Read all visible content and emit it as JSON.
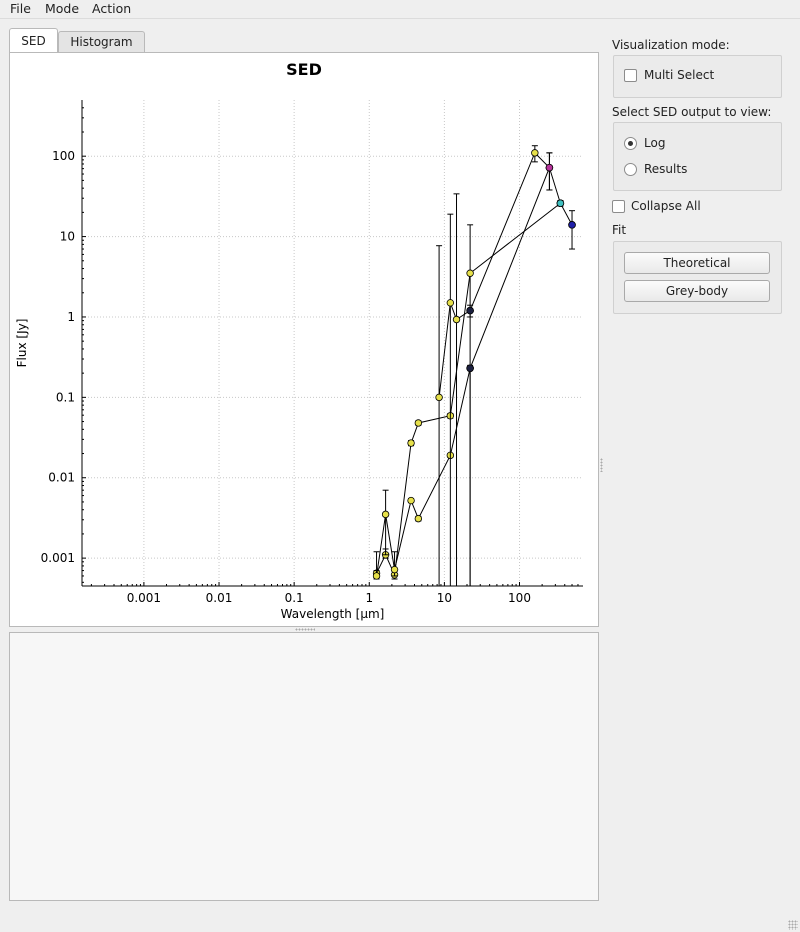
{
  "menubar": {
    "items": [
      "File",
      "Mode",
      "Action"
    ]
  },
  "tabs": [
    "SED",
    "Histogram"
  ],
  "chart_data": {
    "type": "scatter",
    "title": "SED",
    "xlabel": "Wavelength [µm]",
    "ylabel": "Flux [Jy]",
    "xscale": "log",
    "yscale": "log",
    "xlim": [
      0.00015,
      700
    ],
    "ylim": [
      0.00045,
      500
    ],
    "xticks": [
      0.001,
      0.01,
      0.1,
      1,
      10,
      100
    ],
    "xtick_labels": [
      "0.001",
      "0.01",
      "0.1",
      "1",
      "10",
      "100"
    ],
    "yticks": [
      0.001,
      0.01,
      0.1,
      1,
      10,
      100
    ],
    "ytick_labels": [
      "0.001",
      "0.01",
      "0.1",
      "1",
      "10",
      "100"
    ],
    "grid": true,
    "series": [
      {
        "color": "#e6e04a",
        "points": [
          {
            "x": 1.25,
            "y": 0.00065,
            "err": [
              0.0006,
              0.0012
            ]
          },
          {
            "x": 1.65,
            "y": 0.0011,
            "err": [
              0.001,
              0.0013
            ]
          },
          {
            "x": 2.17,
            "y": 0.00062,
            "err": [
              0.00055,
              0.0007
            ]
          },
          {
            "x": 3.6,
            "y": 0.027,
            "err": [
              0.025,
              0.029
            ]
          },
          {
            "x": 4.5,
            "y": 0.048,
            "err": [
              0.045,
              0.051
            ]
          },
          {
            "x": 12,
            "y": 0.059,
            "err": [
              0.055,
              0.063
            ]
          },
          {
            "x": 22,
            "y": 3.5,
            "err": [
              0.0004,
              14
            ]
          },
          {
            "x": 350,
            "y": 26,
            "err": [
              24,
              28
            ]
          }
        ]
      },
      {
        "color": "#e6e04a",
        "points": [
          {
            "x": 1.25,
            "y": 0.0006,
            "err": [
              0.00055,
              0.0007
            ]
          },
          {
            "x": 1.65,
            "y": 0.0035,
            "err": [
              0.0011,
              0.007
            ]
          },
          {
            "x": 2.17,
            "y": 0.00072,
            "err": [
              0.0006,
              0.0012
            ]
          },
          {
            "x": 3.6,
            "y": 0.0052,
            "err": [
              0.0049,
              0.0055
            ]
          },
          {
            "x": 4.5,
            "y": 0.0031,
            "err": [
              0.0029,
              0.0033
            ]
          },
          {
            "x": 12,
            "y": 0.019,
            "err": [
              0.018,
              0.02
            ]
          },
          {
            "x": 22,
            "y": 0.23,
            "err": [
              0.0004,
              0.25
            ]
          },
          {
            "x": 250,
            "y": 72,
            "err": [
              38,
              110
            ]
          }
        ]
      },
      {
        "color": "#e6e04a",
        "points": [
          {
            "x": 8.5,
            "y": 0.1,
            "err": [
              0.0004,
              7.7
            ]
          },
          {
            "x": 12,
            "y": 1.5,
            "err": [
              0.0004,
              19
            ]
          },
          {
            "x": 14.5,
            "y": 0.93,
            "err": [
              0.0004,
              34
            ]
          },
          {
            "x": 22,
            "y": 1.2,
            "err": [
              1.0,
              1.4
            ]
          },
          {
            "x": 160,
            "y": 110,
            "err": [
              85,
              135
            ]
          },
          {
            "x": 250,
            "y": 72,
            "err": [
              38,
              110
            ]
          },
          {
            "x": 350,
            "y": 26,
            "err": [
              24,
              28
            ]
          },
          {
            "x": 500,
            "y": 14,
            "err": [
              7,
              21
            ]
          }
        ]
      }
    ],
    "highlighted_points": [
      {
        "x": 250,
        "y": 72,
        "color": "#b5339a"
      },
      {
        "x": 350,
        "y": 26,
        "color": "#3fbfbf"
      },
      {
        "x": 500,
        "y": 14,
        "color": "#1f1fa8"
      },
      {
        "x": 22,
        "y": 1.2,
        "color": "#1b1f3f"
      },
      {
        "x": 22,
        "y": 0.23,
        "color": "#1b1f3f"
      }
    ]
  },
  "sidebar": {
    "viz_mode_label": "Visualization mode:",
    "multi_select_label": "Multi Select",
    "multi_select_checked": false,
    "sed_output_label": "Select SED output to view:",
    "options": [
      "Log",
      "Results"
    ],
    "selected_option": "Log",
    "collapse_all_label": "Collapse All",
    "collapse_all_checked": false,
    "fit_label": "Fit",
    "fit_buttons": [
      "Theoretical",
      "Grey-body"
    ]
  }
}
